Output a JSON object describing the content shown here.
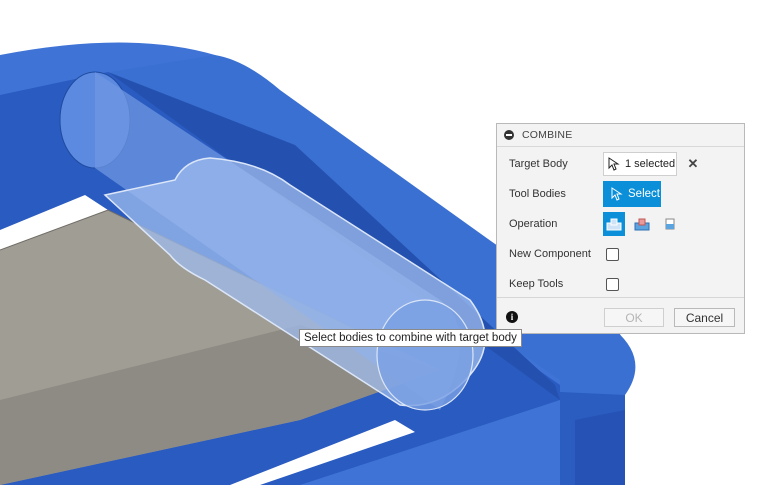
{
  "panel": {
    "title": "COMBINE",
    "rows": {
      "target_body": {
        "label": "Target Body",
        "value": "1 selected"
      },
      "tool_bodies": {
        "label": "Tool Bodies",
        "button_label": "Select"
      },
      "operation": {
        "label": "Operation",
        "options": [
          "join-icon",
          "cut-icon",
          "intersect-icon"
        ],
        "selected": "join-icon"
      },
      "new_component": {
        "label": "New Component",
        "checked": false
      },
      "keep_tools": {
        "label": "Keep Tools",
        "checked": false
      }
    },
    "footer": {
      "ok_label": "OK",
      "cancel_label": "Cancel"
    }
  },
  "tooltip": {
    "text": "Select bodies to combine with target body"
  },
  "colors": {
    "accent": "#0a8fd8",
    "body_blue": "#2e63c6",
    "floor_gray": "#9d9a92",
    "highlight": "#8fb0e6"
  }
}
